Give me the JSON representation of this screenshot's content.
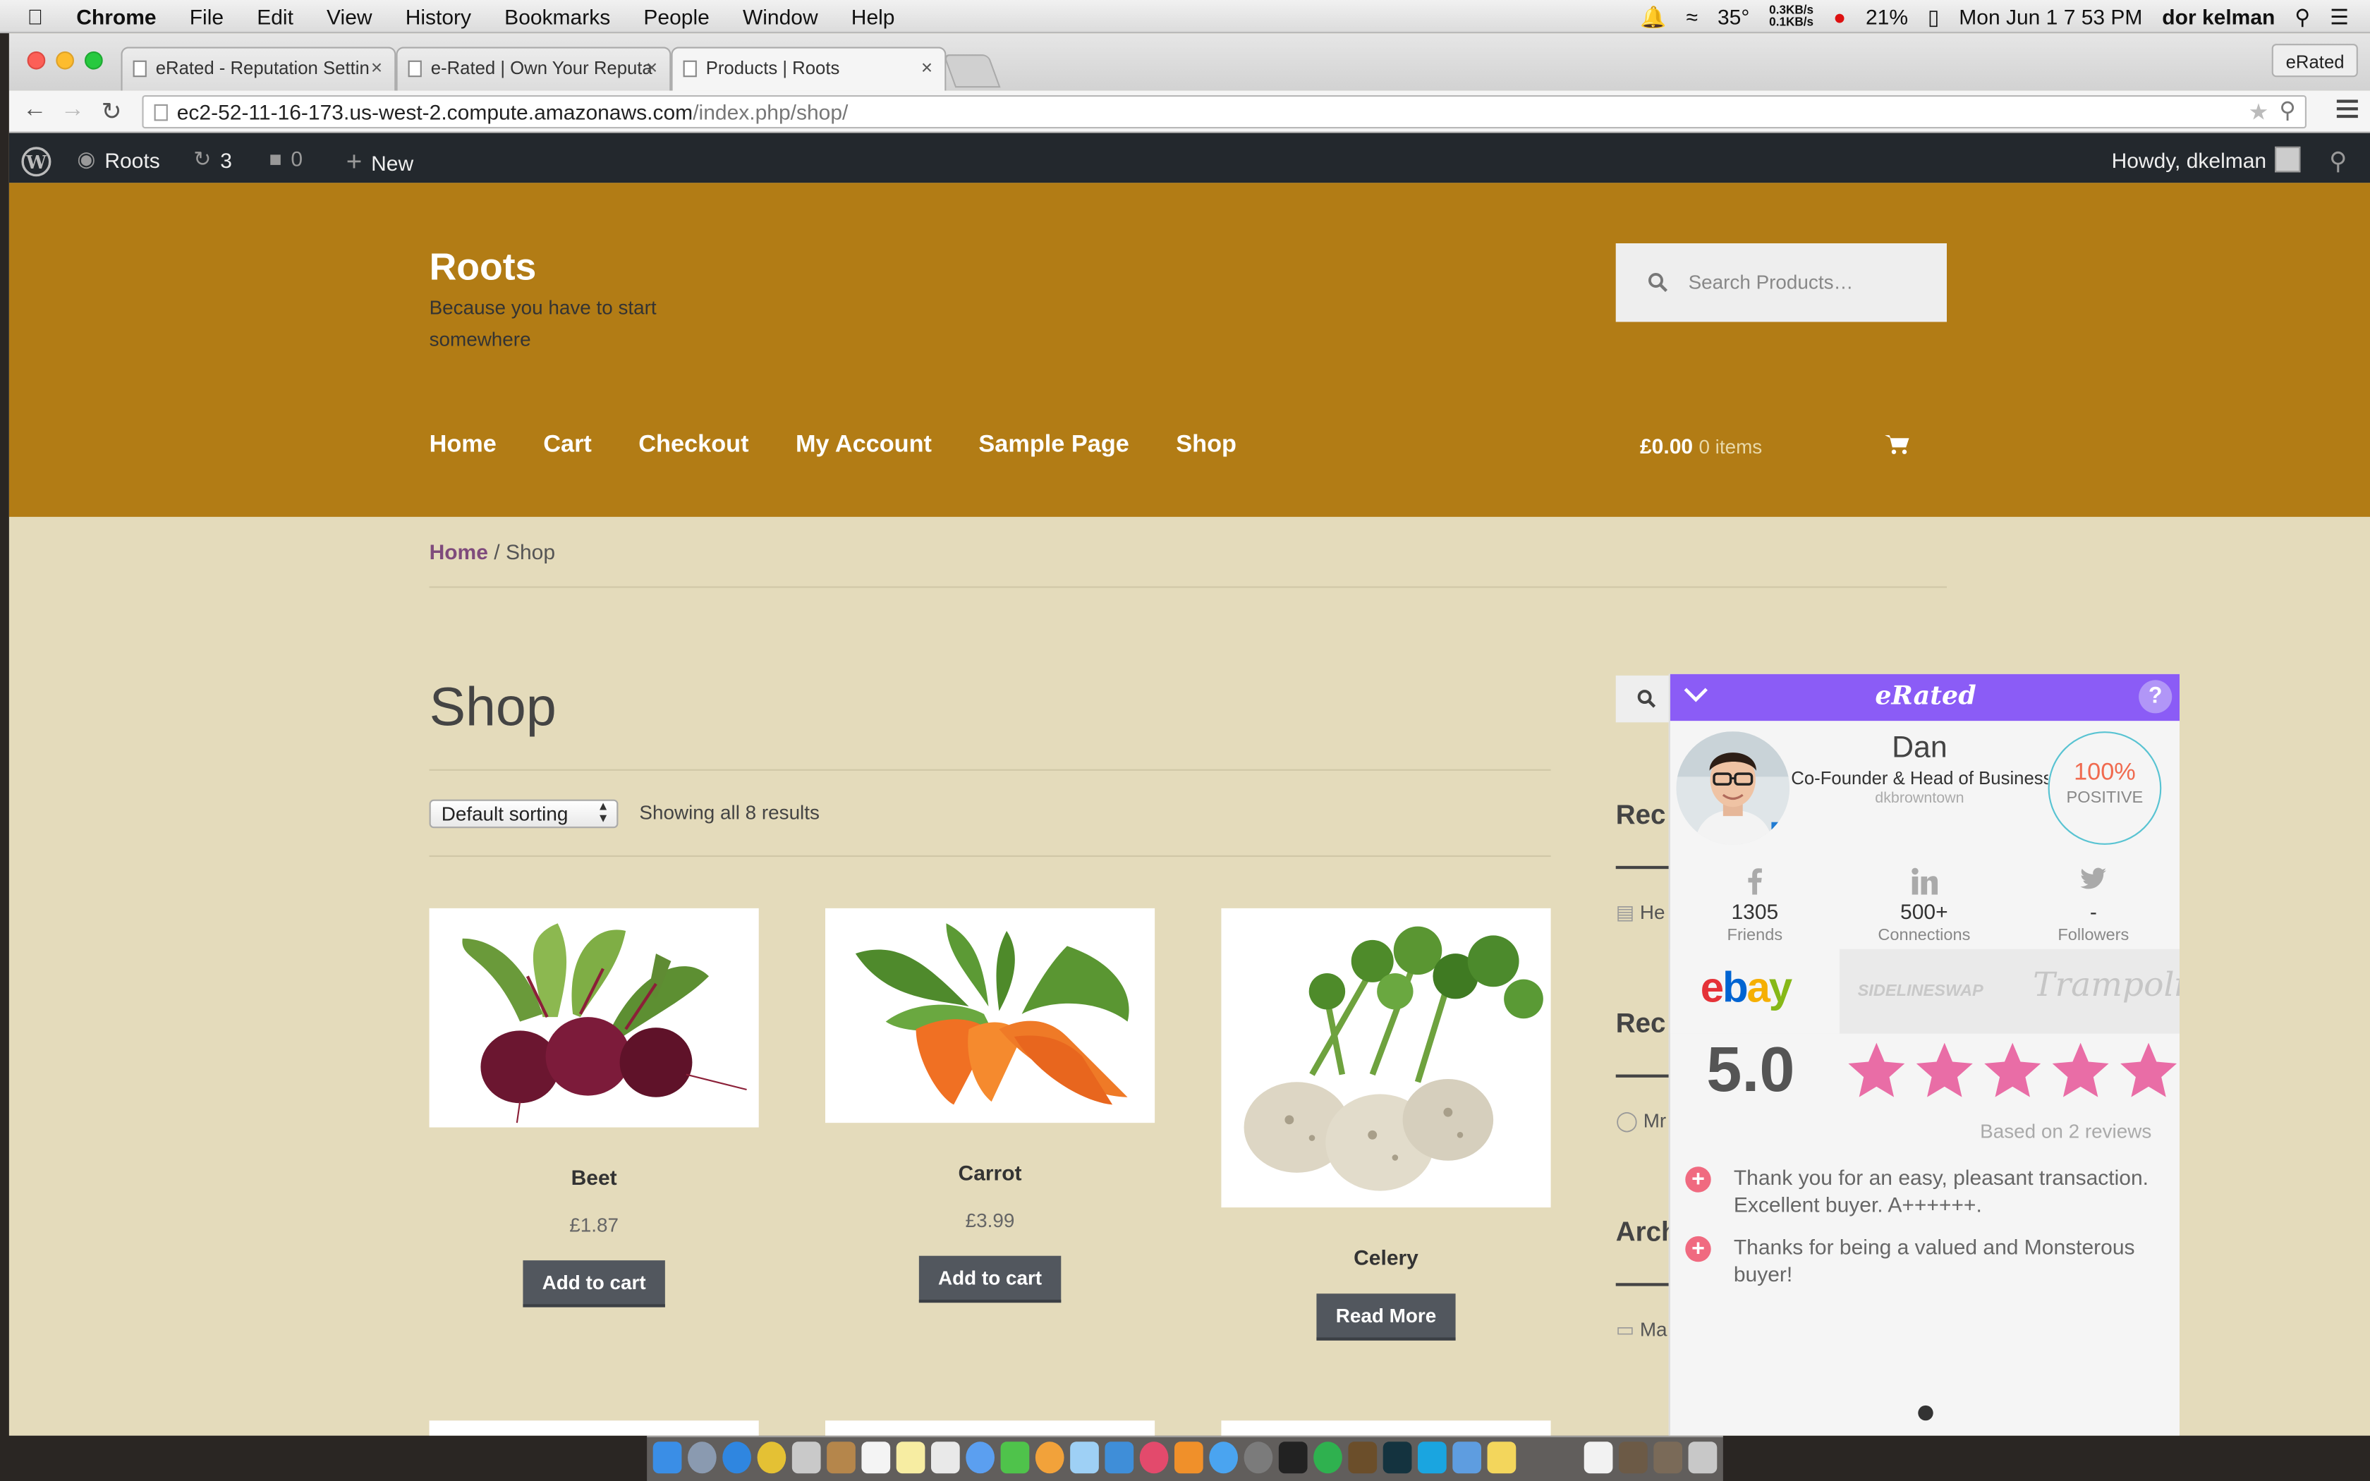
{
  "menubar": {
    "app": "Chrome",
    "menus": [
      "File",
      "Edit",
      "View",
      "History",
      "Bookmarks",
      "People",
      "Window",
      "Help"
    ],
    "temp": "35°",
    "net_up": "0.3KB/s",
    "net_down": "0.1KB/s",
    "battery": "21%",
    "datetime": "Mon Jun 1  7 53 PM",
    "user": "dor kelman"
  },
  "browser": {
    "tabs": [
      {
        "label": "eRated - Reputation Settin",
        "active": false
      },
      {
        "label": "e-Rated | Own Your Reputa",
        "active": false
      },
      {
        "label": "Products | Roots",
        "active": true
      }
    ],
    "profile": "eRated",
    "url_host": "ec2-52-11-16-173.us-west-2.compute.amazonaws.com",
    "url_path": "/index.php/shop/"
  },
  "wpbar": {
    "site": "Roots",
    "updates": "3",
    "comments": "0",
    "new": "New",
    "howdy": "Howdy, dkelman"
  },
  "header": {
    "title": "Roots",
    "tagline": "Because you have to start somewhere",
    "search_placeholder": "Search Products…",
    "nav": [
      "Home",
      "Cart",
      "Checkout",
      "My Account",
      "Sample Page",
      "Shop"
    ],
    "cart_total": "£0.00",
    "cart_items": "0 items"
  },
  "breadcrumb": {
    "home": "Home",
    "sep": " / ",
    "current": "Shop"
  },
  "shop": {
    "title": "Shop",
    "sorting": "Default sorting",
    "results": "Showing all 8 results",
    "products": [
      {
        "name": "Beet",
        "price": "£1.87",
        "button": "Add to cart"
      },
      {
        "name": "Carrot",
        "price": "£3.99",
        "button": "Add to cart"
      },
      {
        "name": "Celery",
        "price": "",
        "button": "Read More"
      }
    ]
  },
  "sidebar": {
    "headings": [
      "Rec",
      "Rec",
      "Arch"
    ],
    "items": [
      "He",
      "Mr",
      "Ma"
    ]
  },
  "erated": {
    "logo": "eRated",
    "help": "?",
    "name": "Dan",
    "role": "Co-Founder & Head of Business Development",
    "username": "dkbrowntown",
    "positive_pct": "100%",
    "positive_label": "POSITIVE",
    "social": [
      {
        "icon": "facebook-icon",
        "value": "1305",
        "label": "Friends"
      },
      {
        "icon": "linkedin-icon",
        "value": "500+",
        "label": "Connections"
      },
      {
        "icon": "twitter-icon",
        "value": "-",
        "label": "Followers"
      }
    ],
    "marketplaces": [
      "ebay",
      "SidelineSwap",
      "Trampoline"
    ],
    "score": "5.0",
    "stars": 5,
    "based_on": "Based on 2 reviews",
    "reviews": [
      "Thank you for an easy, pleasant transaction. Excellent buyer. A++++++.",
      "Thanks for being a valued and Monsterous buyer!"
    ],
    "accent_color": "#8b5cf6",
    "star_color": "#e96da6"
  }
}
